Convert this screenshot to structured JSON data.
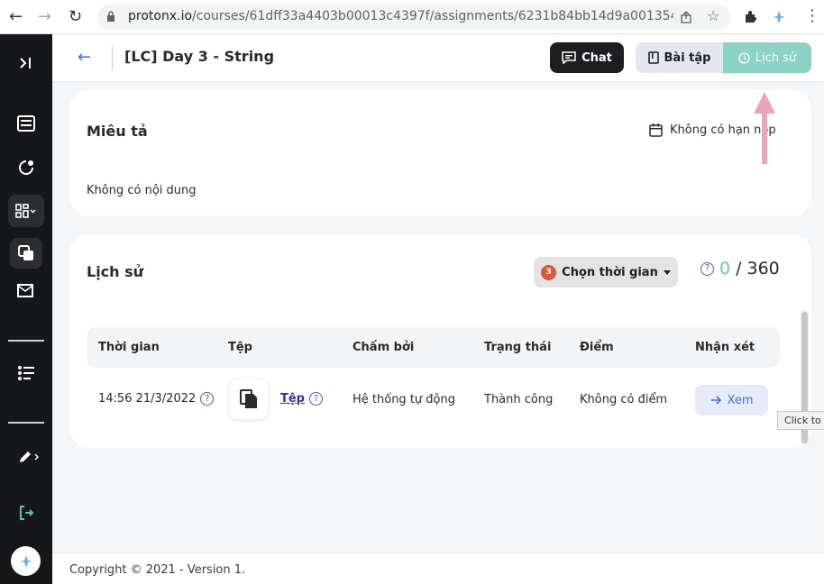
{
  "browser": {
    "url_host": "protonx.io",
    "url_path": "/courses/61dff33a4403b00013c4397f/assignments/6231b84bb14d9a0013545..."
  },
  "header": {
    "title": "[LC] Day 3 - String",
    "chat_label": "Chat",
    "tab_exercise": "Bài tập",
    "tab_history": "Lịch sử"
  },
  "description": {
    "title": "Miêu tả",
    "deadline": "Không có hạn nộp",
    "content": "Không có nội dung"
  },
  "history": {
    "title": "Lịch sử",
    "filter_badge": "3",
    "filter_label": "Chọn thời gian",
    "help": "?",
    "score_got": "0",
    "score_sep": "/",
    "score_total": "360",
    "columns": [
      "Thời gian",
      "Tệp",
      "Chấm bởi",
      "Trạng thái",
      "Điểm",
      "Nhận xét"
    ],
    "rows": [
      {
        "time": "14:56 21/3/2022",
        "file": "Tệp",
        "graded_by": "Hệ thống tự động",
        "status": "Thành công",
        "score": "Không có điểm",
        "action": "Xem"
      }
    ]
  },
  "tooltip": "Click to g",
  "footer": "Copyright © 2021 - Version 1.",
  "colors": {
    "accent_teal": "#8dd3c5",
    "sidebar_bg": "#16171a",
    "annotation_pink": "#eda4bb"
  }
}
